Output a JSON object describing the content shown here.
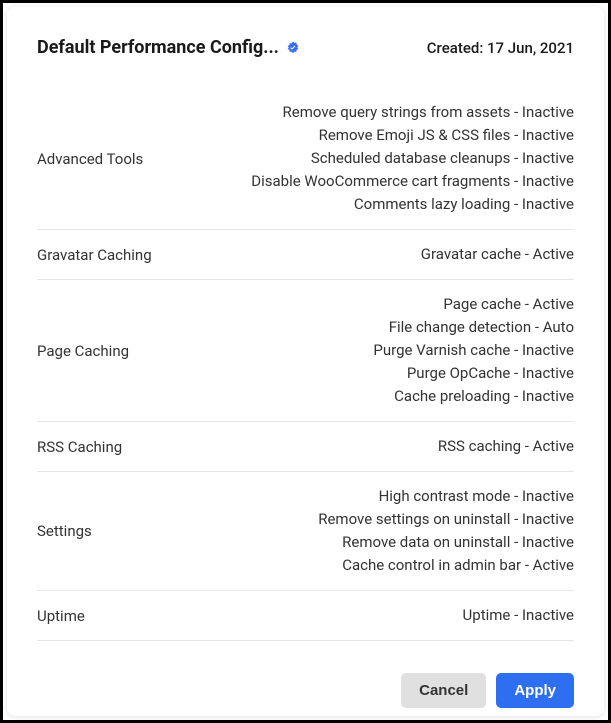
{
  "header": {
    "title": "Default Performance Config...",
    "created_label": "Created: 17 Jun, 2021"
  },
  "sections": [
    {
      "label": "Advanced Tools",
      "items": [
        "Remove query strings from assets - Inactive",
        "Remove Emoji JS & CSS files - Inactive",
        "Scheduled database cleanups - Inactive",
        "Disable WooCommerce cart fragments - Inactive",
        "Comments lazy loading - Inactive"
      ]
    },
    {
      "label": "Gravatar Caching",
      "items": [
        "Gravatar cache - Active"
      ]
    },
    {
      "label": "Page Caching",
      "items": [
        "Page cache - Active",
        "File change detection - Auto",
        "Purge Varnish cache - Inactive",
        "Purge OpCache - Inactive",
        "Cache preloading - Inactive"
      ]
    },
    {
      "label": "RSS Caching",
      "items": [
        "RSS caching - Active"
      ]
    },
    {
      "label": "Settings",
      "items": [
        "High contrast mode - Inactive",
        "Remove settings on uninstall - Inactive",
        "Remove data on uninstall - Inactive",
        "Cache control in admin bar - Active"
      ]
    },
    {
      "label": "Uptime",
      "items": [
        "Uptime - Inactive"
      ]
    }
  ],
  "footer": {
    "cancel_label": "Cancel",
    "apply_label": "Apply"
  }
}
